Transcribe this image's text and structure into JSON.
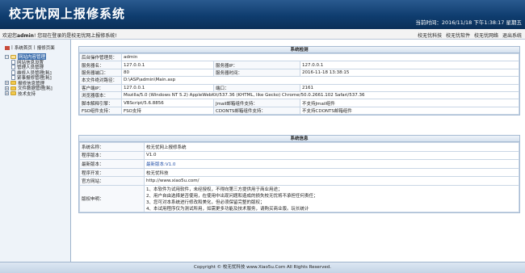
{
  "header": {
    "title": "校无忧网上报修系统",
    "clock": "当前时间：2016/11/18 下午1:38:17 星期五"
  },
  "welcome": {
    "prefix": "欢迎您",
    "username": "admin",
    "suffix": "! 您现在登录的是校无忧网上报修系统!"
  },
  "top_links": [
    "校无忧科技",
    "校无忧软件",
    "校无忧网络",
    "退出系统"
  ],
  "sidebar": {
    "home_label": "系统首页",
    "separator": " | ",
    "report_label": "报修页面",
    "tree": [
      {
        "label": "网站内容管理",
        "kind": "root",
        "selected": true
      },
      {
        "label": "网站信息设置",
        "kind": "leaf"
      },
      {
        "label": "管理人员管理",
        "kind": "leaf"
      },
      {
        "label": "维修人员管理[耗]",
        "kind": "leaf"
      },
      {
        "label": "紧事报修管理[耗]",
        "kind": "leaf"
      },
      {
        "label": "报修信息管理",
        "kind": "folder"
      },
      {
        "label": "文件数据管理[耗]",
        "kind": "folder"
      },
      {
        "label": "技术支持",
        "kind": "folder"
      }
    ]
  },
  "system_check": {
    "heading": "系统检测",
    "admin_label": "后台操作管理员：",
    "admin_value": "admin",
    "server_name_label": "服务器名：",
    "server_name_value": "127.0.0.1",
    "server_ip_label": "服务器IP：",
    "server_ip_value": "127.0.0.1",
    "server_port_label": "服务器端口：",
    "server_port_value": "80",
    "server_time_label": "服务器时间：",
    "server_time_value": "2016-11-18 13:38:15",
    "path_label": "本文件绝对路径：",
    "path_value": "D:\\ASP\\admin\\Main.asp",
    "client_ip_label": "客户端IP：",
    "client_ip_value": "127.0.0.1",
    "client_port_label": "端口：",
    "client_port_value": "2161",
    "browser_label": "浏览器版本：",
    "browser_value": "Mozilla/5.0 (Windows NT 5.2) AppleWebKit/537.36 (KHTML, like Gecko) Chrome/50.0.2661.102 Safari/537.36",
    "script_label": "脚本解释引擎：",
    "script_value": "VBScript/5.6.8856",
    "jmail_label": "Jmail邮箱组件支持：",
    "jmail_value": "不支持Jmail组件",
    "fso_label": "FSO组件支持：",
    "fso_value": "FSO支持",
    "cdonts_label": "CDONTS邮箱组件支持：",
    "cdonts_value": "不支持CDONTS邮箱组件"
  },
  "system_info": {
    "heading": "系统信息",
    "name_label": "系统名称：",
    "name_value": "校无忧网上报修系统",
    "version_label": "程序版本：",
    "version_value": "V1.0",
    "latest_label": "最新版本：",
    "latest_value": "最新版本:V1.0",
    "developer_label": "程序开发：",
    "developer_value": "校无忧科技",
    "site_label": "官方网站：",
    "site_value": "http://www.xiao5u.com/",
    "notice_label": "版权申明：",
    "notice_lines": [
      "1、本软件为试用软件，未经授权，不得向第三方提供用于商业用途；",
      "2、用户自由选择是否使用，在使用中出现问题和造成的损失校无忧将不承担任何责任；",
      "3、您可对本系统进行修改和美化，但必须保留完整的版权；",
      "4、本试用程序仅为测试所用，如需更多功能及技术服务，请购买商业版。玩长统计"
    ]
  },
  "footer": {
    "text": "Copyright © 校无忧科技 www.Xiao5u.Com All Rights Reserved."
  }
}
